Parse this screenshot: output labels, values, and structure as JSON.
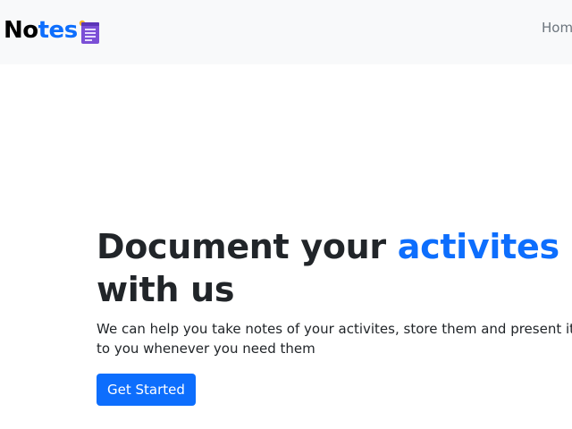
{
  "navbar": {
    "brand_part1": "No",
    "brand_part2": "tes",
    "logo_icon": "notepad-icon",
    "links": [
      {
        "label": "Home"
      }
    ]
  },
  "hero": {
    "title_part1": "Document your ",
    "title_accent": "activites",
    "title_part2": "with us",
    "lead_line1": "We can help you take notes of your activites, store them and present it",
    "lead_line2": "to you whenever you need them",
    "cta_label": "Get Started"
  },
  "colors": {
    "accent": "#0d6efd",
    "navbar_bg": "#f8f9fa",
    "text": "#212529",
    "logo": "#7b4fd6"
  }
}
